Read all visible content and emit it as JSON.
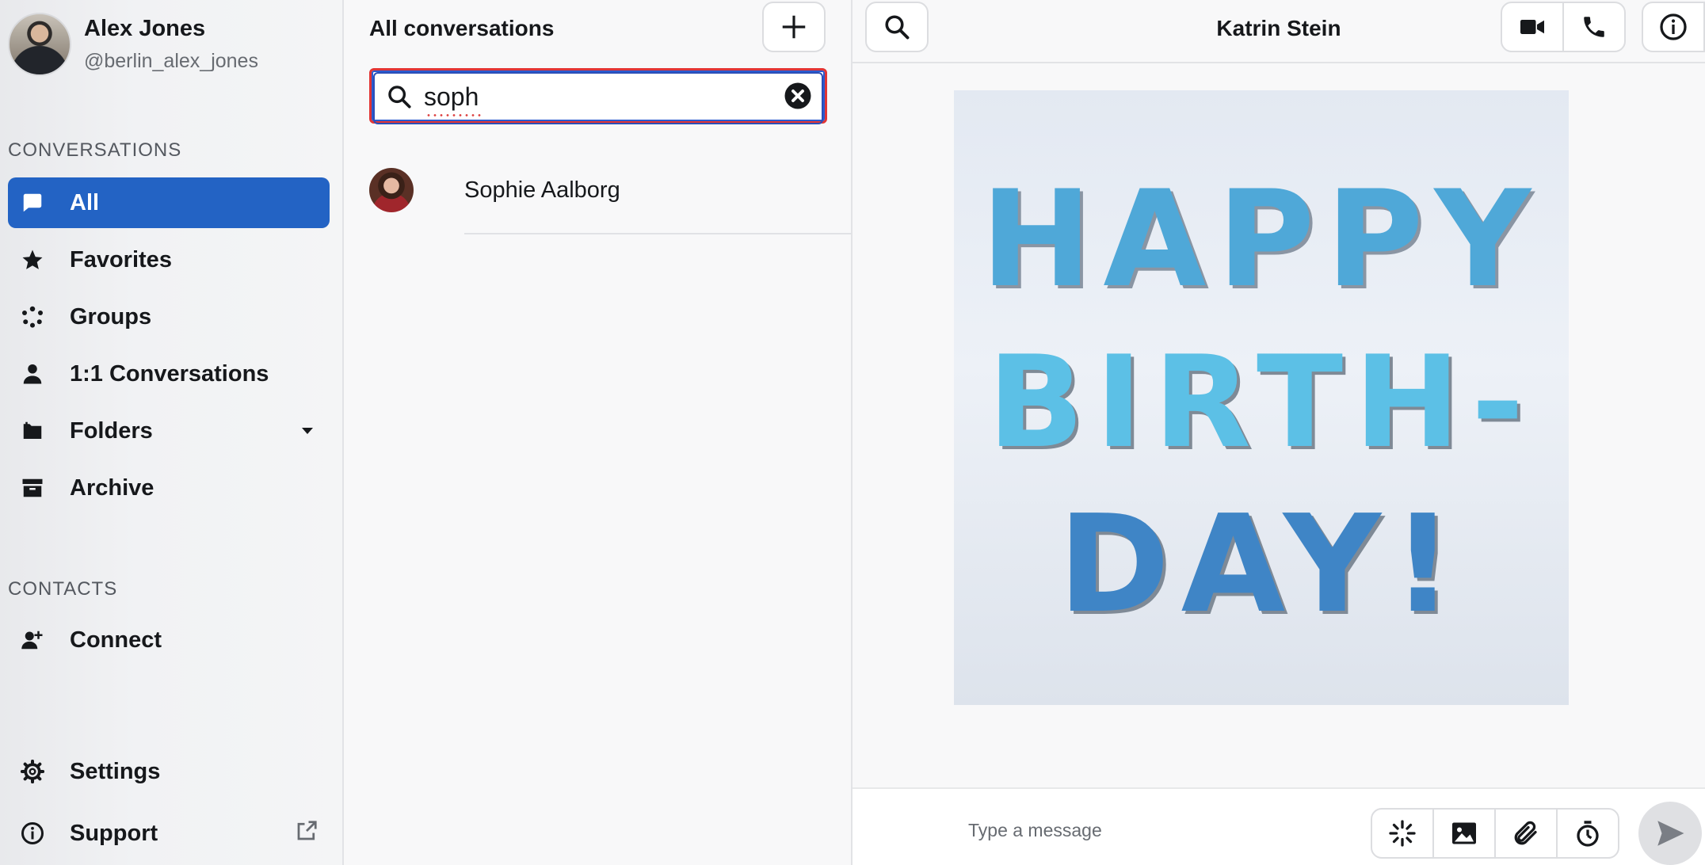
{
  "user": {
    "name": "Alex Jones",
    "handle": "@berlin_alex_jones"
  },
  "sidebar": {
    "conversations_heading": "CONVERSATIONS",
    "items": [
      {
        "label": "All",
        "icon": "chat-bubble-icon",
        "active": true
      },
      {
        "label": "Favorites",
        "icon": "star-icon"
      },
      {
        "label": "Groups",
        "icon": "groups-icon"
      },
      {
        "label": "1:1 Conversations",
        "icon": "person-icon"
      },
      {
        "label": "Folders",
        "icon": "folder-icon"
      },
      {
        "label": "Archive",
        "icon": "archive-icon"
      }
    ],
    "contacts_heading": "CONTACTS",
    "connect_label": "Connect",
    "settings_label": "Settings",
    "support_label": "Support"
  },
  "conversations": {
    "title": "All conversations",
    "search_value": "soph",
    "results": [
      {
        "name": "Sophie Aalborg"
      }
    ]
  },
  "chat": {
    "title": "Katrin Stein",
    "gif_lines": [
      "HAPPY",
      "BIRTH-",
      "DAY!"
    ],
    "composer_placeholder": "Type a message"
  },
  "colors": {
    "accent": "#2363c4",
    "focus_outline": "#e23535"
  }
}
